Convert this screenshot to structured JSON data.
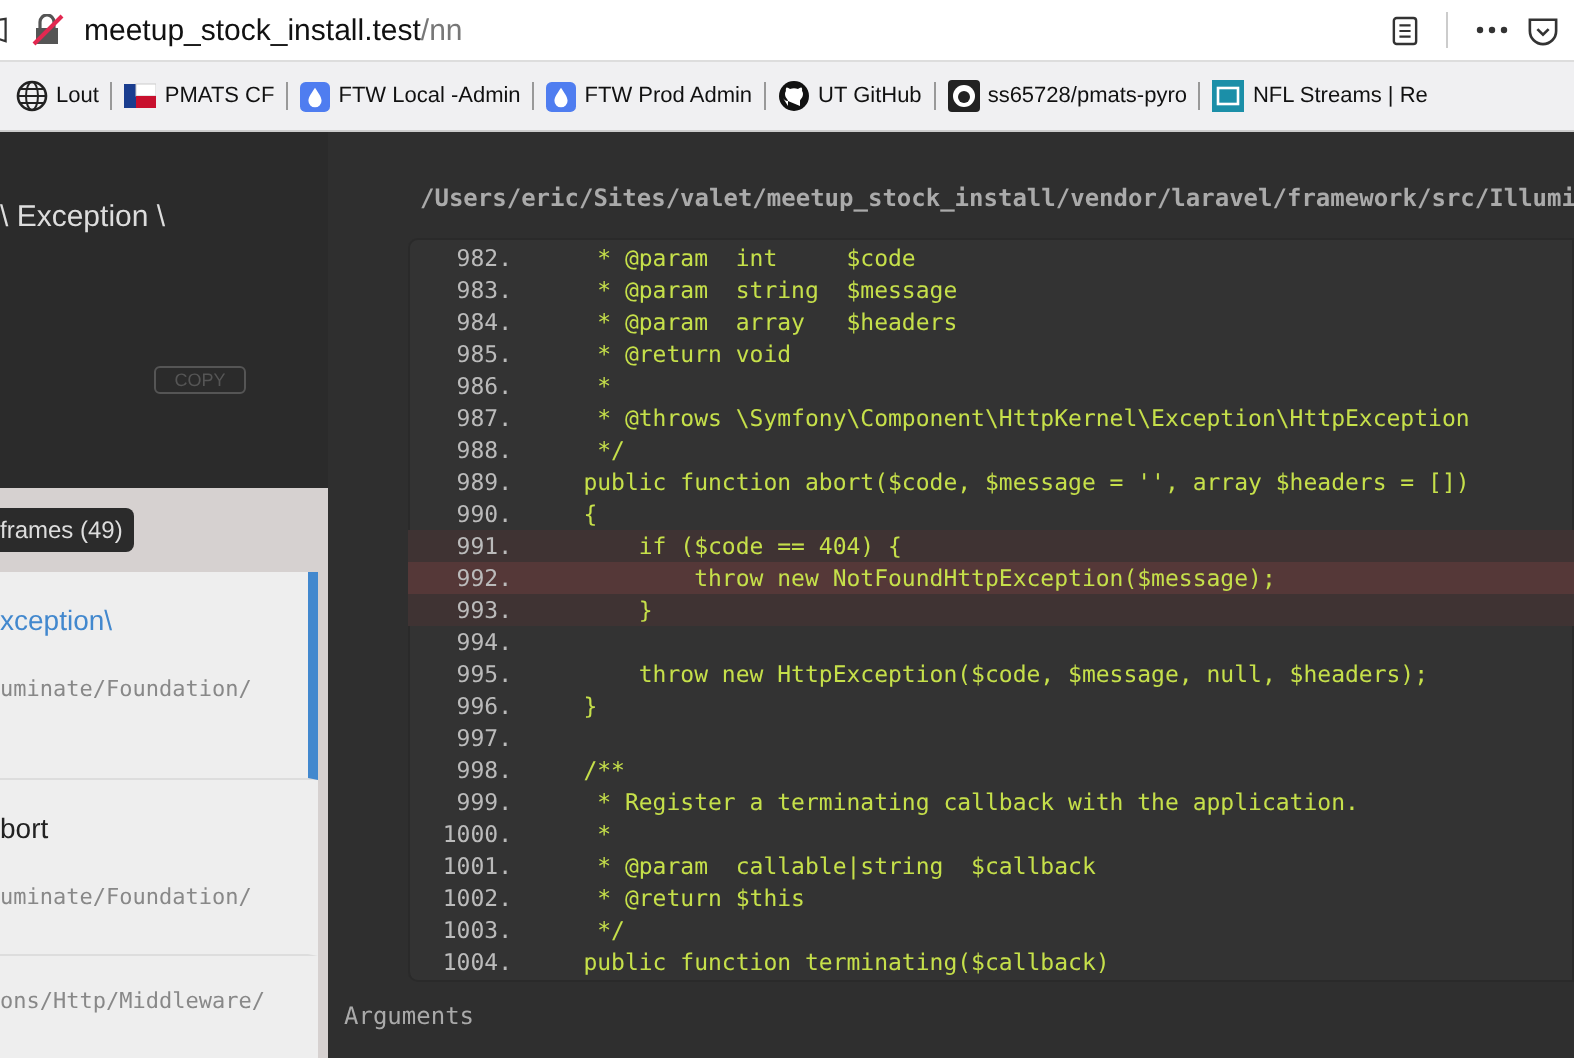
{
  "browser": {
    "url_host": "meetup_stock_install.test",
    "url_path": "/nn",
    "bookmarks": [
      {
        "label": "Lout"
      },
      {
        "label": "PMATS CF"
      },
      {
        "label": "FTW Local -Admin"
      },
      {
        "label": "FTW Prod Admin"
      },
      {
        "label": "UT GitHub"
      },
      {
        "label": "ss65728/pmats-pyro"
      },
      {
        "label": "NFL Streams | Re"
      }
    ]
  },
  "exception": {
    "title": "\\ Exception \\",
    "copy_button": "COPY"
  },
  "frames_toggle": "frames (49)",
  "frames": [
    {
      "name": "xception\\",
      "path": "uminate/Foundation/",
      "selected": true
    },
    {
      "name": "bort",
      "path": "uminate/Foundation/",
      "selected": false
    },
    {
      "path": "ons/Http/Middleware/",
      "selected": false
    }
  ],
  "file_path": "/Users/eric/Sites/valet/meetup_stock_install/vendor/laravel/framework/src/Illumi",
  "code_lines": [
    {
      "number": "982.",
      "text": "     * @param  int     $code",
      "highlighted": false,
      "current": false
    },
    {
      "number": "983.",
      "text": "     * @param  string  $message",
      "highlighted": false,
      "current": false
    },
    {
      "number": "984.",
      "text": "     * @param  array   $headers",
      "highlighted": false,
      "current": false
    },
    {
      "number": "985.",
      "text": "     * @return void",
      "highlighted": false,
      "current": false
    },
    {
      "number": "986.",
      "text": "     *",
      "highlighted": false,
      "current": false
    },
    {
      "number": "987.",
      "text": "     * @throws \\Symfony\\Component\\HttpKernel\\Exception\\HttpException",
      "highlighted": false,
      "current": false
    },
    {
      "number": "988.",
      "text": "     */",
      "highlighted": false,
      "current": false
    },
    {
      "number": "989.",
      "text": "    public function abort($code, $message = '', array $headers = [])",
      "highlighted": false,
      "current": false
    },
    {
      "number": "990.",
      "text": "    {",
      "highlighted": false,
      "current": false
    },
    {
      "number": "991.",
      "text": "        if ($code == 404) {",
      "highlighted": true,
      "current": false
    },
    {
      "number": "992.",
      "text": "            throw new NotFoundHttpException($message);",
      "highlighted": true,
      "current": true
    },
    {
      "number": "993.",
      "text": "        }",
      "highlighted": true,
      "current": false
    },
    {
      "number": "994.",
      "highlighted": false,
      "current": false
    },
    {
      "number": "995.",
      "text": "        throw new HttpException($code, $message, null, $headers);",
      "highlighted": false,
      "current": false
    },
    {
      "number": "996.",
      "text": "    }",
      "highlighted": false,
      "current": false
    },
    {
      "number": "997.",
      "highlighted": false,
      "current": false
    },
    {
      "number": "998.",
      "text": "    /**",
      "highlighted": false,
      "current": false
    },
    {
      "number": "999.",
      "text": "     * Register a terminating callback with the application.",
      "highlighted": false,
      "current": false
    },
    {
      "number": "1000.",
      "text": "     *",
      "highlighted": false,
      "current": false
    },
    {
      "number": "1001.",
      "text": "     * @param  callable|string  $callback",
      "highlighted": false,
      "current": false
    },
    {
      "number": "1002.",
      "text": "     * @return $this",
      "highlighted": false,
      "current": false
    },
    {
      "number": "1003.",
      "text": "     */",
      "highlighted": false,
      "current": false
    },
    {
      "number": "1004.",
      "text": "    public function terminating($callback)",
      "highlighted": false,
      "current": false
    }
  ],
  "arguments_label": "Arguments"
}
